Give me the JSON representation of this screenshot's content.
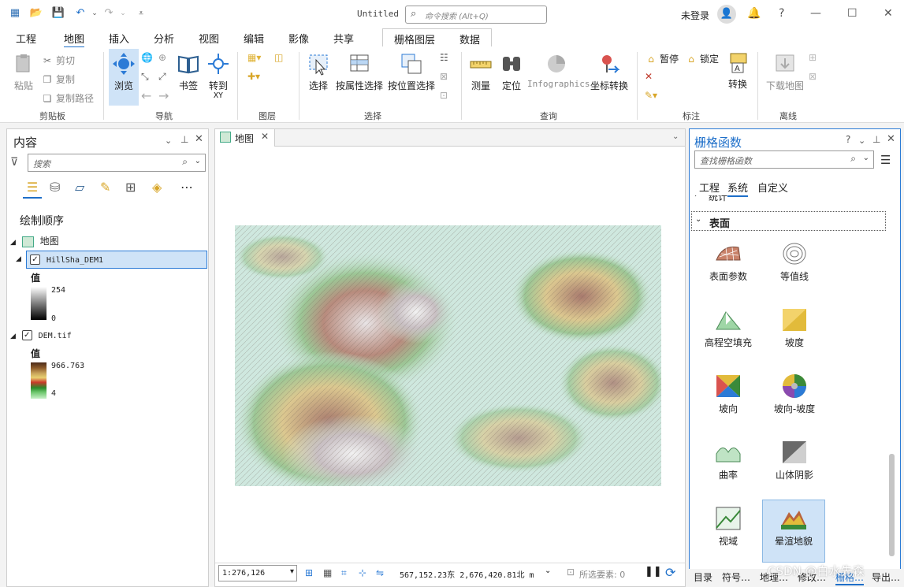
{
  "window": {
    "title": "Untitled",
    "command_search_placeholder": "命令搜索 (Alt+Q)",
    "login_label": "未登录",
    "help_label": "?"
  },
  "ribbon_tabs": [
    "工程",
    "地图",
    "插入",
    "分析",
    "视图",
    "编辑",
    "影像",
    "共享"
  ],
  "context_tabs": [
    "栅格图层",
    "数据"
  ],
  "ribbon": {
    "clipboard": {
      "paste": "粘贴",
      "cut": "剪切",
      "copy": "复制",
      "copy_path": "复制路径",
      "group": "剪贴板"
    },
    "navigate": {
      "explore": "浏览",
      "bookmarks": "书签",
      "goto_xy": "转到\nXY",
      "group": "导航"
    },
    "layer": {
      "group": "图层"
    },
    "selection": {
      "select": "选择",
      "by_attr": "按属性选择",
      "by_loc": "按位置选择",
      "group": "选择"
    },
    "inquiry": {
      "measure": "测量",
      "locate": "定位",
      "infographics": "Infographics",
      "coord": "坐标转换",
      "group": "查询"
    },
    "labeling": {
      "pause": "暂停",
      "lock": "锁定",
      "convert": "转换",
      "group": "标注"
    },
    "offline": {
      "download": "下载地图",
      "group": "离线"
    }
  },
  "contents": {
    "title": "内容",
    "search_placeholder": "搜索",
    "draw_order": "绘制顺序",
    "map_name": "地图",
    "layers": [
      {
        "name": "HillSha_DEM1",
        "checked": true,
        "legend_title": "值",
        "max": "254",
        "min": "0"
      },
      {
        "name": "DEM.tif",
        "checked": true,
        "legend_title": "值",
        "max": "966.763",
        "min": "4"
      }
    ]
  },
  "map_tab": {
    "label": "地图"
  },
  "status": {
    "scale": "1:276,126",
    "coords": "567,152.23东 2,676,420.81北 m",
    "selected": "所选要素: 0"
  },
  "raster_functions": {
    "title": "栅格函数",
    "search_placeholder": "查找栅格函数",
    "tabs": [
      "工程",
      "系统",
      "自定义"
    ],
    "active_tab": "系统",
    "category": "表面",
    "collapsed_category": "统计",
    "items": [
      "表面参数",
      "等值线",
      "高程空填充",
      "坡度",
      "坡向",
      "坡向-坡度",
      "曲率",
      "山体阴影",
      "视域",
      "晕渲地貌"
    ],
    "selected": "晕渲地貌"
  },
  "bottom_tabs": [
    "目录",
    "符号…",
    "地理…",
    "修改…",
    "栅格…",
    "导出…"
  ],
  "watermark": "CSDN @白水先森",
  "colors": {
    "accent": "#1e6fc9",
    "selection": "#cfe3f7"
  }
}
